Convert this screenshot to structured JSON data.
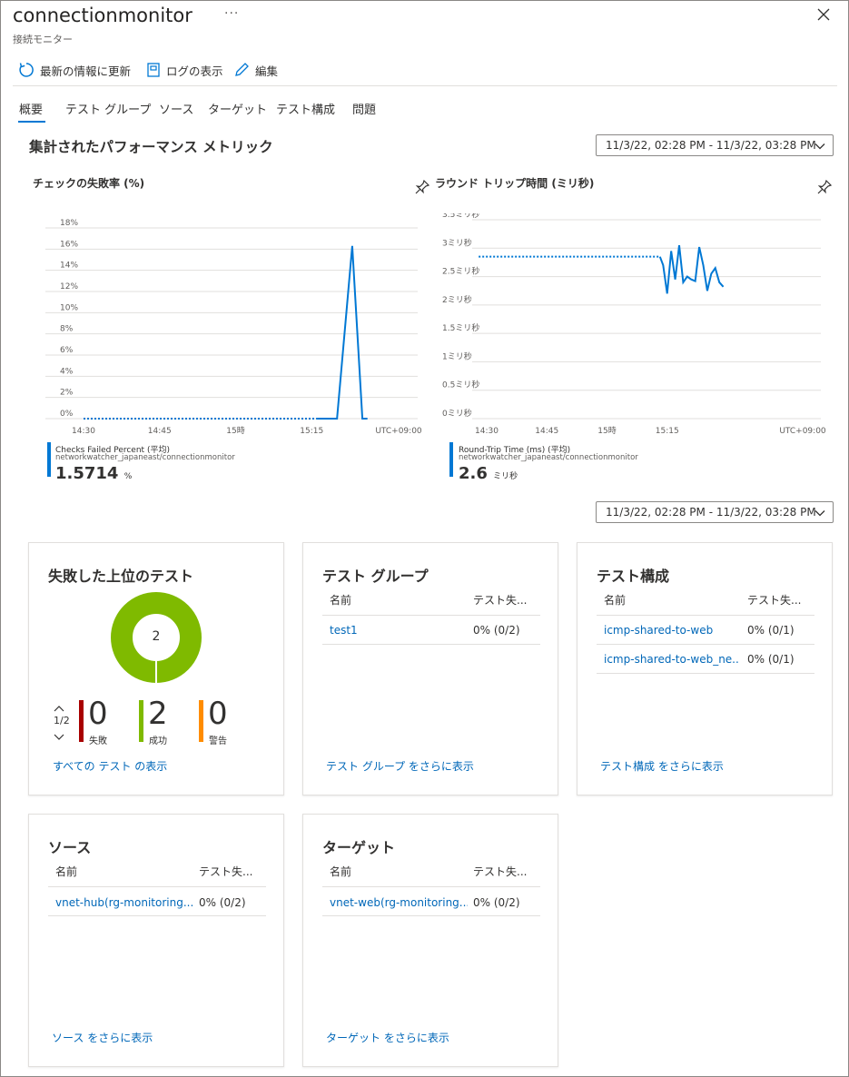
{
  "header": {
    "title": "connectionmonitor",
    "subtitle": "接続モニター",
    "more_icon": "ellipsis-icon",
    "close_icon": "close-icon"
  },
  "toolbar": {
    "refresh_label": "最新の情報に更新",
    "logs_label": "ログの表示",
    "edit_label": "編集"
  },
  "tabs": [
    {
      "label": "概要",
      "selected": true
    },
    {
      "label": "テスト グループ"
    },
    {
      "label": "ソース"
    },
    {
      "label": "ターゲット"
    },
    {
      "label": "テスト構成"
    },
    {
      "label": "問題"
    }
  ],
  "metrics": {
    "heading": "集計されたパフォーマンス メトリック",
    "time_range": "11/3/22, 02:28 PM - 11/3/22, 03:28 PM",
    "time_range_2": "11/3/22, 02:28 PM - 11/3/22, 03:28 PM"
  },
  "colors": {
    "accent": "#0078d4",
    "success": "#7fba00",
    "fail": "#a80000",
    "warning": "#ff8c00",
    "link": "#0067b8"
  },
  "chart_data": [
    {
      "type": "line",
      "title": "チェックの失敗率 (%)",
      "y_ticks": [
        "18%",
        "16%",
        "14%",
        "12%",
        "10%",
        "8%",
        "6%",
        "4%",
        "2%",
        "0%"
      ],
      "x_ticks": [
        "14:30",
        "14:45",
        "15時",
        "15:15",
        "UTC+09:00"
      ],
      "ylim": [
        0,
        18
      ],
      "series": [
        {
          "name": "Checks Failed Percent (平均)",
          "resource": "networkwatcher_japaneast/connectionmonitor",
          "summary_value": "1.5714",
          "summary_unit": "%",
          "dotted_x": [
            0,
            46
          ],
          "dotted_y": 0,
          "x": [
            46,
            50,
            53,
            55,
            56
          ],
          "y": [
            0,
            0,
            16.3,
            0,
            0
          ]
        }
      ],
      "x_minutes": [
        0,
        15,
        30,
        45,
        60
      ]
    },
    {
      "type": "line",
      "title": "ラウンド トリップ時間 (ミリ秒)",
      "y_ticks": [
        "3.5ミリ秒",
        "3ミリ秒",
        "2.5ミリ秒",
        "2ミリ秒",
        "1.5ミリ秒",
        "1ミリ秒",
        "0.5ミリ秒",
        "0ミリ秒"
      ],
      "x_ticks": [
        "14:30",
        "14:45",
        "15時",
        "15:15",
        "UTC+09:00"
      ],
      "ylim": [
        0,
        3.5
      ],
      "series": [
        {
          "name": "Round-Trip Time (ms) (平均)",
          "resource": "networkwatcher_japaneast/connectionmonitor",
          "summary_value": "2.6",
          "summary_unit": "ミリ秒",
          "dotted_x": [
            -2,
            43.2
          ],
          "dotted_y": 2.85,
          "x": [
            43.2,
            44,
            45,
            46,
            47,
            48,
            49,
            50,
            51,
            52,
            53,
            54,
            55,
            56,
            57,
            58,
            59
          ],
          "y": [
            2.85,
            2.7,
            2.2,
            2.95,
            2.45,
            3.05,
            2.4,
            2.5,
            2.45,
            2.42,
            3.02,
            2.7,
            2.25,
            2.55,
            2.65,
            2.4,
            2.32
          ]
        }
      ],
      "x_minutes": [
        0,
        15,
        30,
        45,
        60
      ]
    }
  ],
  "top_failed": {
    "title": "失敗した上位のテスト",
    "donut_center": "2",
    "pager": "1/2",
    "fail": {
      "value": "0",
      "label": "失敗"
    },
    "success": {
      "value": "2",
      "label": "成功"
    },
    "warning": {
      "value": "0",
      "label": "警告"
    },
    "success_fraction": 1.0,
    "link": "すべての テスト の表示"
  },
  "test_groups": {
    "title": "テスト グループ",
    "col_name": "名前",
    "col_fail": "テスト失...",
    "rows": [
      {
        "name": "test1",
        "value": "0% (0/2)"
      }
    ],
    "link": "テスト グループ をさらに表示"
  },
  "test_configs": {
    "title": "テスト構成",
    "col_name": "名前",
    "col_fail": "テスト失...",
    "rows": [
      {
        "name": "icmp-shared-to-web",
        "value": "0% (0/1)"
      },
      {
        "name": "icmp-shared-to-web_ne...",
        "value": "0% (0/1)"
      }
    ],
    "link": "テスト構成 をさらに表示"
  },
  "sources": {
    "title": "ソース",
    "col_name": "名前",
    "col_fail": "テスト失...",
    "rows": [
      {
        "name": "vnet-hub(rg-monitoring...",
        "value": "0% (0/2)"
      }
    ],
    "link": "ソース をさらに表示"
  },
  "targets": {
    "title": "ターゲット",
    "col_name": "名前",
    "col_fail": "テスト失...",
    "rows": [
      {
        "name": "vnet-web(rg-monitoring...",
        "value": "0% (0/2)"
      }
    ],
    "link": "ターゲット をさらに表示"
  }
}
